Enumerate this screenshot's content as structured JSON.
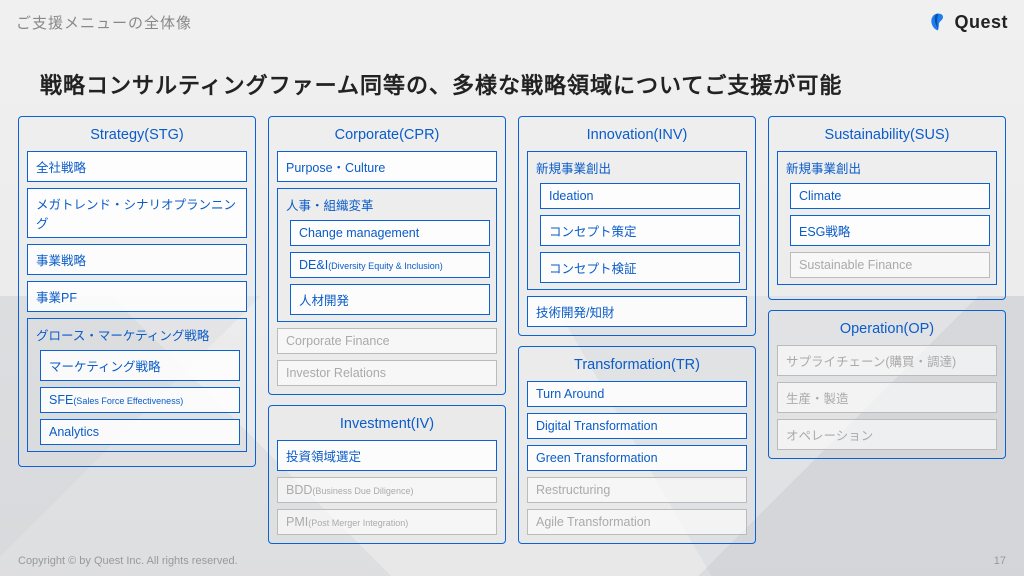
{
  "header": {
    "title": "ご支援メニューの全体像",
    "brand": "Quest"
  },
  "headline": "戦略コンサルティングファーム同等の、多様な戦略領域についてご支援が可能",
  "cols": [
    {
      "cards": [
        {
          "title": "Strategy(STG)",
          "rows": [
            {
              "t": "item",
              "label": "全社戦略"
            },
            {
              "t": "item",
              "label": "メガトレンド・シナリオプランニング"
            },
            {
              "t": "item",
              "label": "事業戦略"
            },
            {
              "t": "item",
              "label": "事業PF"
            },
            {
              "t": "group",
              "label": "グロース・マーケティング戦略",
              "subs": [
                {
                  "label": "マーケティング戦略"
                },
                {
                  "label": "SFE",
                  "note": "(Sales Force Effectiveness)"
                },
                {
                  "label": "Analytics"
                }
              ]
            }
          ]
        }
      ]
    },
    {
      "cards": [
        {
          "title": "Corporate(CPR)",
          "rows": [
            {
              "t": "item",
              "label": "Purpose・Culture"
            },
            {
              "t": "group",
              "label": "人事・組織変革",
              "subs": [
                {
                  "label": "Change management"
                },
                {
                  "label": "DE&I",
                  "note": "(Diversity Equity & Inclusion)"
                },
                {
                  "label": "人材開発"
                }
              ]
            },
            {
              "t": "item",
              "label": "Corporate Finance",
              "dim": true
            },
            {
              "t": "item",
              "label": "Investor Relations",
              "dim": true
            }
          ]
        },
        {
          "title": "Investment(IV)",
          "rows": [
            {
              "t": "item",
              "label": "投資領域選定"
            },
            {
              "t": "item",
              "label": "BDD",
              "note": "(Business Due Diligence)",
              "dim": true
            },
            {
              "t": "item",
              "label": "PMI",
              "note": "(Post Merger Integration)",
              "dim": true
            }
          ]
        }
      ]
    },
    {
      "cards": [
        {
          "title": "Innovation(INV)",
          "rows": [
            {
              "t": "group",
              "label": "新規事業創出",
              "subs": [
                {
                  "label": "Ideation"
                },
                {
                  "label": "コンセプト策定"
                },
                {
                  "label": "コンセプト検証"
                }
              ]
            },
            {
              "t": "item",
              "label": "技術開発/知財"
            }
          ]
        },
        {
          "title": "Transformation(TR)",
          "rows": [
            {
              "t": "item",
              "label": "Turn Around"
            },
            {
              "t": "item",
              "label": "Digital Transformation"
            },
            {
              "t": "item",
              "label": "Green Transformation"
            },
            {
              "t": "item",
              "label": "Restructuring",
              "dim": true
            },
            {
              "t": "item",
              "label": "Agile Transformation",
              "dim": true
            }
          ]
        }
      ]
    },
    {
      "cards": [
        {
          "title": "Sustainability(SUS)",
          "rows": [
            {
              "t": "group",
              "label": "新規事業創出",
              "subs": [
                {
                  "label": "Climate"
                },
                {
                  "label": "ESG戦略"
                },
                {
                  "label": "Sustainable Finance",
                  "dim": true
                }
              ]
            }
          ]
        },
        {
          "title": "Operation(OP)",
          "rows": [
            {
              "t": "item",
              "label": "サプライチェーン(購買・調達)",
              "dim": true
            },
            {
              "t": "item",
              "label": "生産・製造",
              "dim": true
            },
            {
              "t": "item",
              "label": "オペレーション",
              "dim": true
            }
          ]
        }
      ]
    }
  ],
  "footer": {
    "copyright": "Copyright © by Quest Inc. All rights reserved.",
    "page": "17"
  }
}
